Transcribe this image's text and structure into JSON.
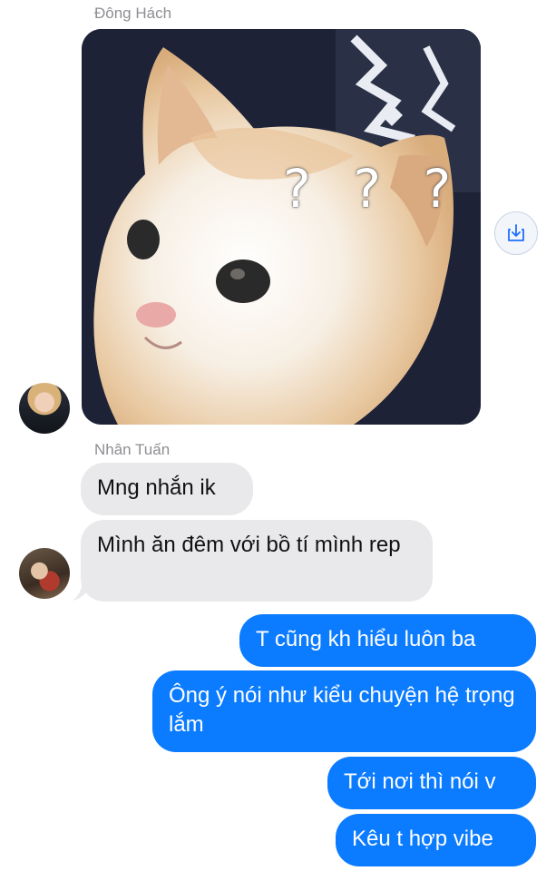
{
  "thread": {
    "sender_1": "Đông Hách",
    "sender_2": "Nhân Tuấn",
    "image_message": {
      "overlay_marks": "? ? ?",
      "save_icon": "download-icon"
    },
    "incoming": [
      "Mng nhắn ik",
      "Mình ăn đêm với bồ tí mình rep"
    ],
    "outgoing": [
      "T cũng kh hiểu luôn ba",
      "Ông ý nói như kiểu chuyện hệ trọng lắm",
      "Tới nơi thì nói v",
      "Kêu t hợp vibe"
    ],
    "colors": {
      "outgoing_bubble": "#0b7bff",
      "incoming_bubble": "#e9e9eb",
      "sender_name": "#8e8e93"
    }
  }
}
